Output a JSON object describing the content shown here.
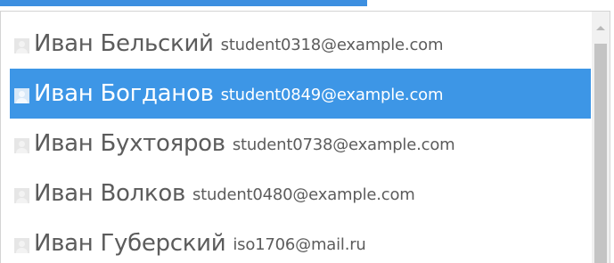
{
  "dropdown": {
    "items": [
      {
        "name": "Иван Бельский",
        "email": "student0318@example.com",
        "selected": false
      },
      {
        "name": "Иван Богданов",
        "email": "student0849@example.com",
        "selected": true
      },
      {
        "name": "Иван Бухтояров",
        "email": "student0738@example.com",
        "selected": false
      },
      {
        "name": "Иван Волков",
        "email": "student0480@example.com",
        "selected": false
      },
      {
        "name": "Иван Губерский",
        "email": "iso1706@mail.ru",
        "selected": false
      }
    ],
    "selected_index": 1
  },
  "icons": {
    "avatar": "user-avatar-icon",
    "scroll_up": "chevron-up-icon"
  },
  "colors": {
    "selected_background": "#3d96e6",
    "top_field_border": "#3d8fe0",
    "text": "#5c5c5c",
    "selected_text": "#ffffff"
  }
}
